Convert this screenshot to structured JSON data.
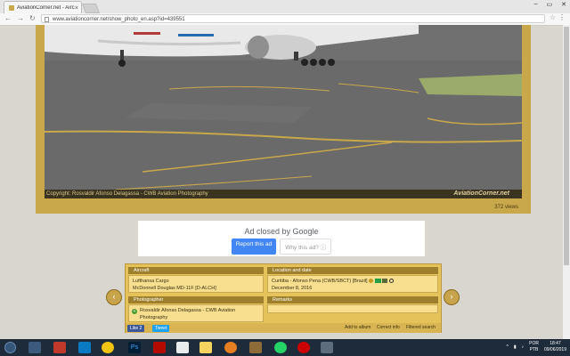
{
  "browser": {
    "tab_title": "AviationCorner.net - Airc",
    "tab_close": "×",
    "url": "www.aviationcorner.net/show_photo_en.asp?id=439551",
    "window_controls": [
      "–",
      "▭",
      "✕"
    ],
    "back_icon": "back-arrow-icon",
    "forward_icon": "forward-arrow-icon",
    "reload_icon": "reload-icon"
  },
  "photo": {
    "copyright_label": "Copyright",
    "copyright_text": "Rosvaldir Afonso Delagassa - CWB Aviation Photography",
    "watermark": "AviationCorner.net",
    "view_count": "372",
    "views_label": "views"
  },
  "ad": {
    "closed_prefix": "Ad closed by",
    "closed_brand": "Google",
    "report_label": "Report this ad",
    "why_label": "Why this ad?"
  },
  "info": {
    "aircraft_header": "Aircraft",
    "airline": "Lufthansa Cargo",
    "aircraft_type": "McDonnell Douglas MD-11F [D-ALCH]",
    "location_header": "Location and date",
    "location": "Curitiba - Afonso Pena (CWB/SBCT) [Brazil]",
    "date": "December 8, 2016",
    "photographer_header": "Photographer",
    "photographer": "Rosvaldir Afonso Delagassa - CWB Aviation Photography",
    "remarks_header": "Remarks",
    "like_label": "Like 2",
    "tweet_label": "Tweet",
    "add_album": "Add to album",
    "correct_info": "Correct info",
    "filtered_search": "Filtered search"
  },
  "nav": {
    "prev": "‹",
    "next": "›"
  },
  "taskbar": {
    "language": "POR",
    "language_sub": "PTB",
    "time": "18:47",
    "date": "09/06/2019"
  },
  "colors": {
    "frame_gold": "#c8a84b",
    "panel_gold": "#e6c35a",
    "header_brown": "#9d7f2c",
    "ad_blue": "#4285f4"
  }
}
